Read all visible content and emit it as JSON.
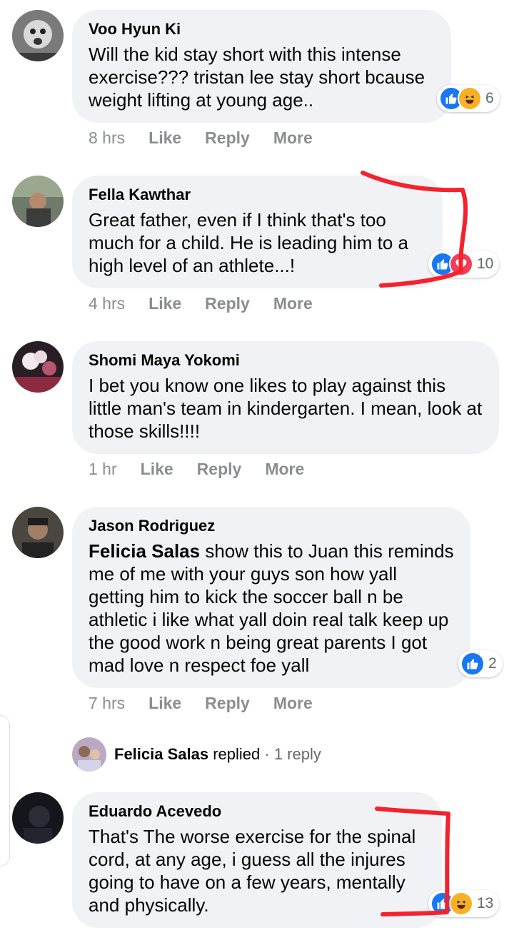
{
  "comments": [
    {
      "author": "Voo Hyun Ki",
      "text": "Will the kid stay short with this intense exercise??? tristan lee stay short bcause weight lifting at young age..",
      "time": "8 hrs",
      "like": "Like",
      "reply": "Reply",
      "more": "More",
      "reactions": [
        "like-icon",
        "haha-icon"
      ],
      "reaction_count": "6"
    },
    {
      "author": "Fella Kawthar",
      "text": "Great father, even if I think that's too much for a child. He is leading him to a high level of an athlete...!",
      "time": "4 hrs",
      "like": "Like",
      "reply": "Reply",
      "more": "More",
      "reactions": [
        "like-icon",
        "love-icon"
      ],
      "reaction_count": "10"
    },
    {
      "author": "Shomi Maya Yokomi",
      "text": "I bet you know one likes to play against this little man's team in kindergarten. I mean, look at those skills!!!!",
      "time": "1 hr",
      "like": "Like",
      "reply": "Reply",
      "more": "More"
    },
    {
      "author": "Jason Rodriguez",
      "mention": "Felicia Salas",
      "text": " show this to Juan this reminds me of me with your guys son how yall getting him to kick the soccer ball n be athletic i like what yall doin real talk keep up the good work n being great parents I got mad love n respect foe yall",
      "time": "7 hrs",
      "like": "Like",
      "reply": "Reply",
      "more": "More",
      "reactions": [
        "like-icon"
      ],
      "reaction_count": "2"
    },
    {
      "author": "Eduardo Acevedo",
      "text": "That's The worse exercise for the spinal cord, at any age, i guess all the injures going to have on a few years, mentally and physically.",
      "reactions": [
        "like-icon",
        "haha-icon"
      ],
      "reaction_count": "13"
    }
  ],
  "reply_summary": {
    "name": "Felicia Salas",
    "verb": " replied",
    "sep": " · ",
    "count": "1 reply"
  },
  "colors": {
    "bubble": "#f0f2f5",
    "meta_text": "#8a8d91",
    "like_blue": "#1877f2",
    "love_red": "#f33e58",
    "haha_yellow": "#f7b125",
    "annotation_red": "#f5222d"
  }
}
